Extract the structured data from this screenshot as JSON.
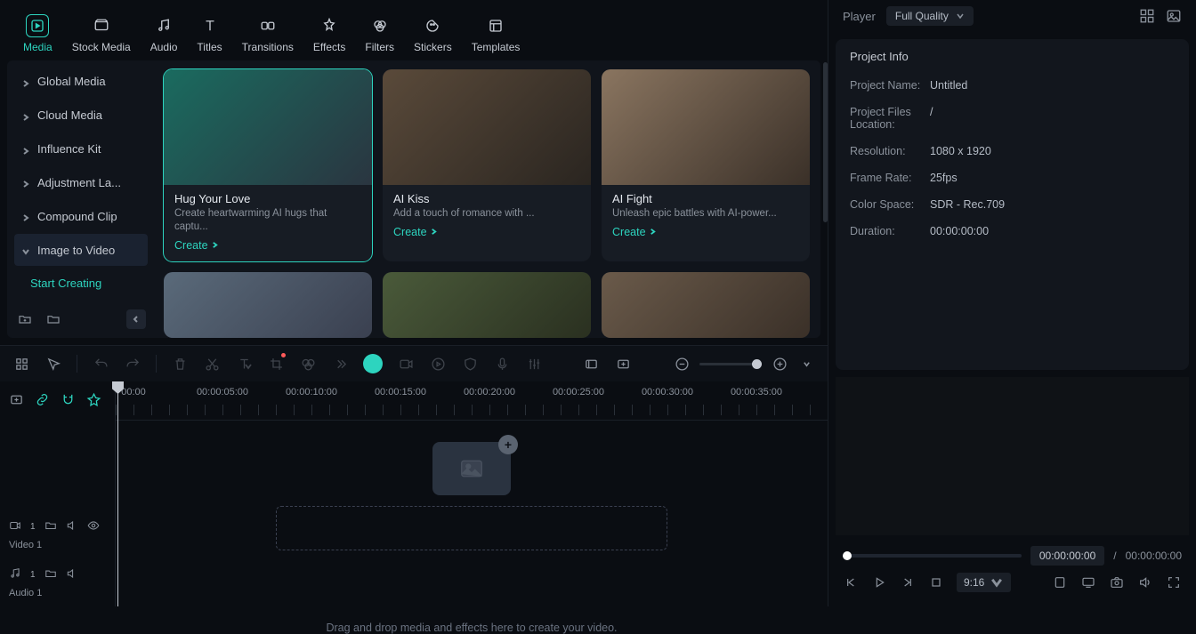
{
  "tabs": [
    {
      "label": "Media"
    },
    {
      "label": "Stock Media"
    },
    {
      "label": "Audio"
    },
    {
      "label": "Titles"
    },
    {
      "label": "Transitions"
    },
    {
      "label": "Effects"
    },
    {
      "label": "Filters"
    },
    {
      "label": "Stickers"
    },
    {
      "label": "Templates"
    }
  ],
  "sidebar": {
    "items": [
      {
        "label": "Global Media"
      },
      {
        "label": "Cloud Media"
      },
      {
        "label": "Influence Kit"
      },
      {
        "label": "Adjustment La..."
      },
      {
        "label": "Compound Clip"
      },
      {
        "label": "Image to Video"
      }
    ],
    "start": "Start Creating"
  },
  "cards": [
    {
      "title": "Hug Your Love",
      "desc": "Create heartwarming AI hugs that captu...",
      "create": "Create"
    },
    {
      "title": "AI Kiss",
      "desc": "Add a touch of romance with ...",
      "create": "Create"
    },
    {
      "title": "AI Fight",
      "desc": "Unleash epic battles with AI-power...",
      "create": "Create"
    }
  ],
  "project": {
    "title": "Project Info",
    "rows": [
      {
        "label": "Project Name:",
        "value": "Untitled"
      },
      {
        "label": "Project Files Location:",
        "value": "/"
      },
      {
        "label": "Resolution:",
        "value": "1080 x 1920"
      },
      {
        "label": "Frame Rate:",
        "value": "25fps"
      },
      {
        "label": "Color Space:",
        "value": "SDR - Rec.709"
      },
      {
        "label": "Duration:",
        "value": "00:00:00:00"
      }
    ]
  },
  "player": {
    "label": "Player",
    "quality": "Full Quality",
    "current": "00:00:00:00",
    "total": "00:00:00:00",
    "ratio": "9:16"
  },
  "timeline": {
    "ticks": [
      "00:00",
      "00:00:05:00",
      "00:00:10:00",
      "00:00:15:00",
      "00:00:20:00",
      "00:00:25:00",
      "00:00:30:00",
      "00:00:35:00"
    ],
    "dropText": "Drag and drop media and effects here to create your video.",
    "tracks": [
      {
        "label": "Video 1",
        "badge": "1"
      },
      {
        "label": "Audio 1",
        "badge": "1"
      }
    ]
  }
}
